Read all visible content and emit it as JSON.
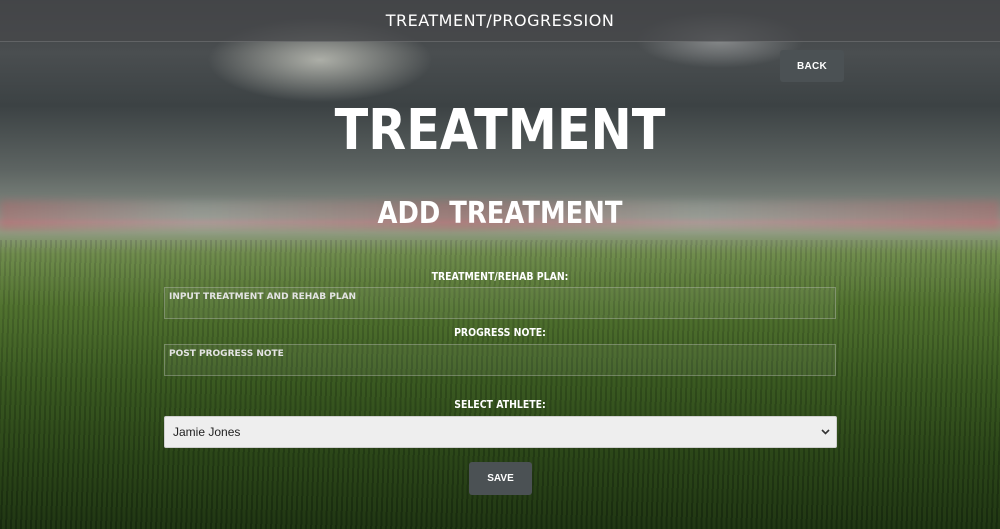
{
  "header": {
    "title": "TREATMENT/PROGRESSION"
  },
  "nav": {
    "back_label": "BACK"
  },
  "page": {
    "title": "TREATMENT",
    "subtitle": "ADD TREATMENT"
  },
  "form": {
    "plan": {
      "label": "TREATMENT/REHAB PLAN:",
      "placeholder": "INPUT TREATMENT AND REHAB PLAN",
      "value": ""
    },
    "progress": {
      "label": "PROGRESS NOTE:",
      "placeholder": "POST PROGRESS NOTE",
      "value": ""
    },
    "athlete": {
      "label": "SELECT ATHLETE:",
      "selected": "Jamie Jones"
    },
    "save_label": "SAVE"
  },
  "icons": {
    "select_chevron": "chevron-down-icon"
  },
  "colors": {
    "button_bg": "#4b5154",
    "select_bg": "#eeeeee"
  }
}
